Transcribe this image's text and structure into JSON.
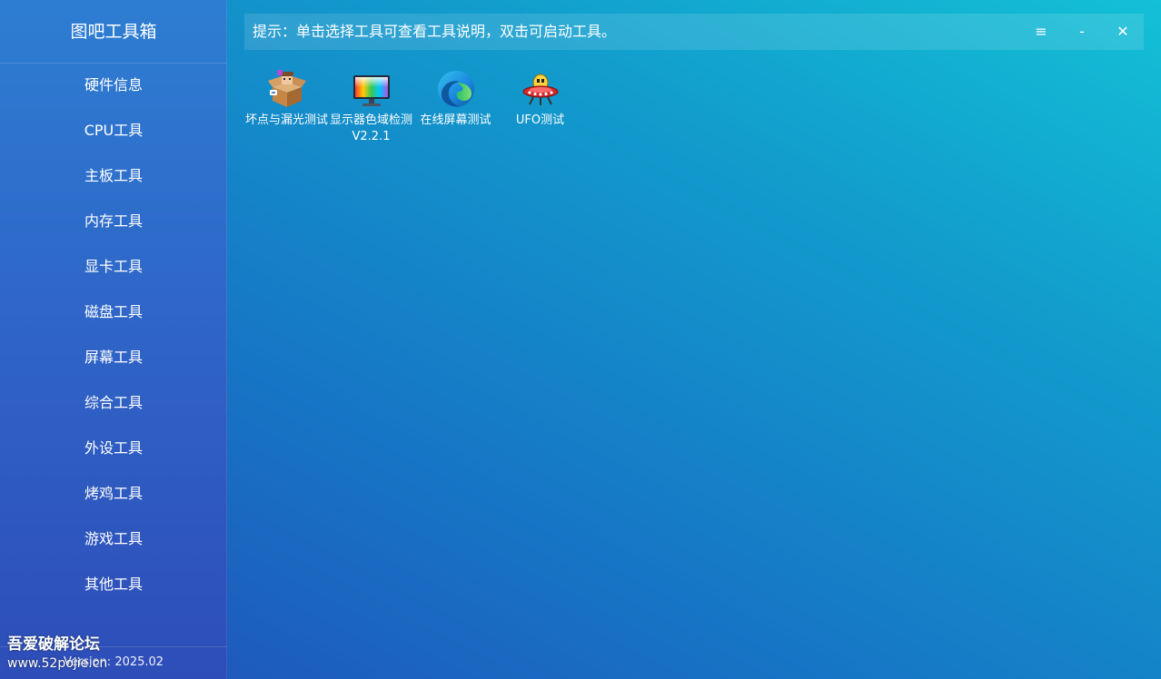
{
  "app": {
    "title": "图吧工具箱",
    "version": "Version: 2025.02"
  },
  "sidebar": {
    "items": [
      {
        "label": "硬件信息"
      },
      {
        "label": "CPU工具"
      },
      {
        "label": "主板工具"
      },
      {
        "label": "内存工具"
      },
      {
        "label": "显卡工具"
      },
      {
        "label": "磁盘工具"
      },
      {
        "label": "屏幕工具"
      },
      {
        "label": "综合工具"
      },
      {
        "label": "外设工具"
      },
      {
        "label": "烤鸡工具"
      },
      {
        "label": "游戏工具"
      },
      {
        "label": "其他工具"
      }
    ]
  },
  "topbar": {
    "hint": "提示：单击选择工具可查看工具说明，双击可启动工具。",
    "menu_icon": "≡",
    "minimize_icon": "-",
    "close_icon": "✕"
  },
  "tools": [
    {
      "label": "坏点与漏光测试",
      "icon": "box-character-icon"
    },
    {
      "label": "显示器色域检测V2.2.1",
      "icon": "color-monitor-icon"
    },
    {
      "label": "在线屏幕测试",
      "icon": "edge-browser-icon"
    },
    {
      "label": "UFO测试",
      "icon": "ufo-icon"
    }
  ],
  "watermark": {
    "title": "吾爱破解论坛",
    "url": "www.52pojie.cn"
  },
  "colors": {
    "sidebar_top": "#2d7ed2",
    "sidebar_bottom": "#2e4db8",
    "main_bottom_left": "#2150b8",
    "main_top_right": "#13c0d6",
    "text": "#ffffff"
  }
}
